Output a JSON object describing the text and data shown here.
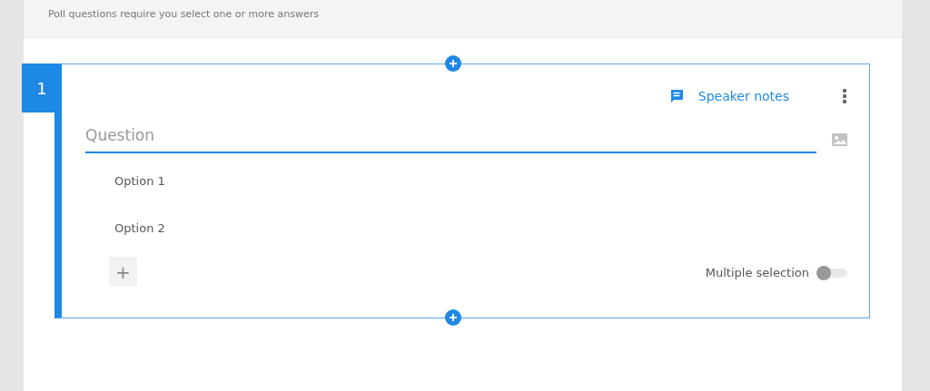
{
  "header": {
    "hint": "Poll questions require you select one or more answers"
  },
  "question": {
    "number": "1",
    "speaker_notes": "Speaker notes",
    "placeholder": "Question",
    "options": [
      {
        "label": "Option 1"
      },
      {
        "label": "Option 2"
      }
    ],
    "add_option": "+",
    "multiple_selection": {
      "label": "Multiple selection",
      "on": false
    }
  }
}
